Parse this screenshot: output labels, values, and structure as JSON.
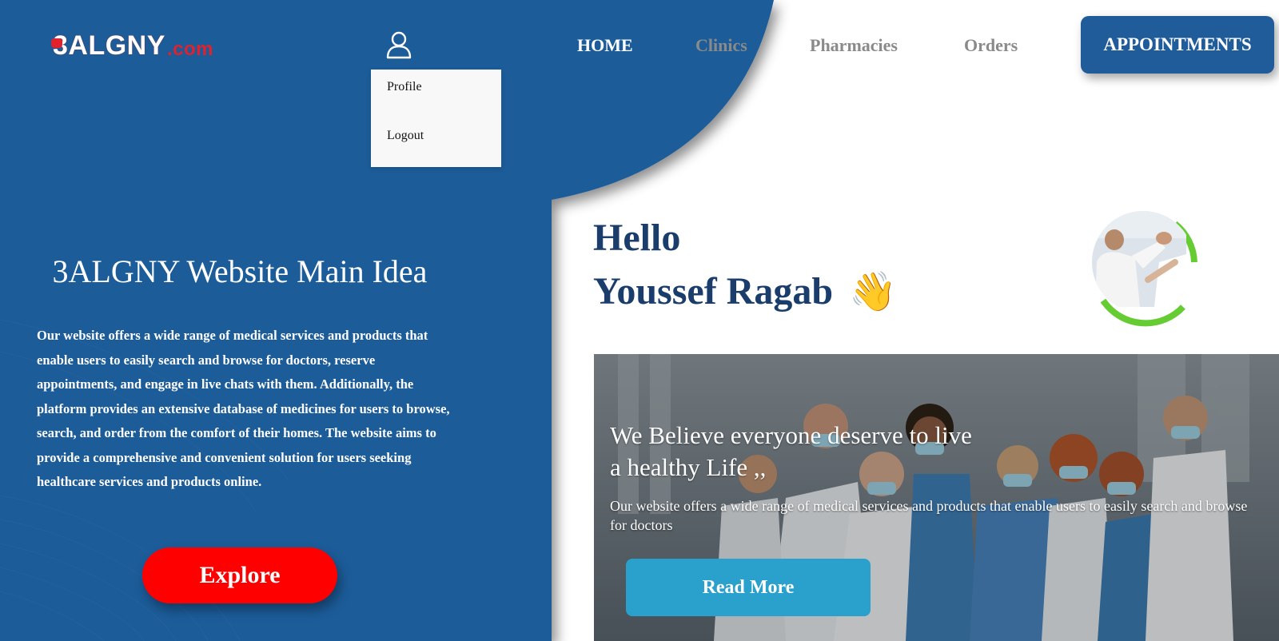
{
  "colors": {
    "primary_blue": "#1f5c99",
    "dark_navy": "#1a3d6b",
    "explore_red": "#ff0000",
    "read_more_cyan": "#2aa0cc",
    "nav_gray": "#8a8a8a"
  },
  "header": {
    "logo": {
      "text_main": "3ALGNY",
      "text_suffix": ".com"
    },
    "user_icon": "user-icon",
    "dropdown": {
      "items": [
        "Profile",
        "Logout"
      ]
    },
    "nav": {
      "home": "HOME",
      "clinics": "Clinics",
      "pharmacies": "Pharmacies",
      "orders": "Orders",
      "appointments": "APPOINTMENTS"
    }
  },
  "left_panel": {
    "title": "3ALGNY Website Main Idea",
    "description": "Our website offers a wide range of medical services and products that enable users to easily search and browse for doctors, reserve appointments, and engage in live chats with them. Additionally, the platform provides an extensive database of medicines for users to browse, search, and order from the comfort of their homes. The website aims to provide a comprehensive and convenient solution for users seeking healthcare services and products online.",
    "explore_button": "Explore"
  },
  "greeting": {
    "hello": "Hello",
    "name": "Youssef Ragab",
    "wave_emoji": "👋"
  },
  "banner": {
    "heading": "We Believe everyone deserve to live a healthy Life ,,",
    "text": "Our website offers a wide range of medical services and products that enable users to easily search and browse for doctors",
    "read_more_button": "Read More"
  }
}
